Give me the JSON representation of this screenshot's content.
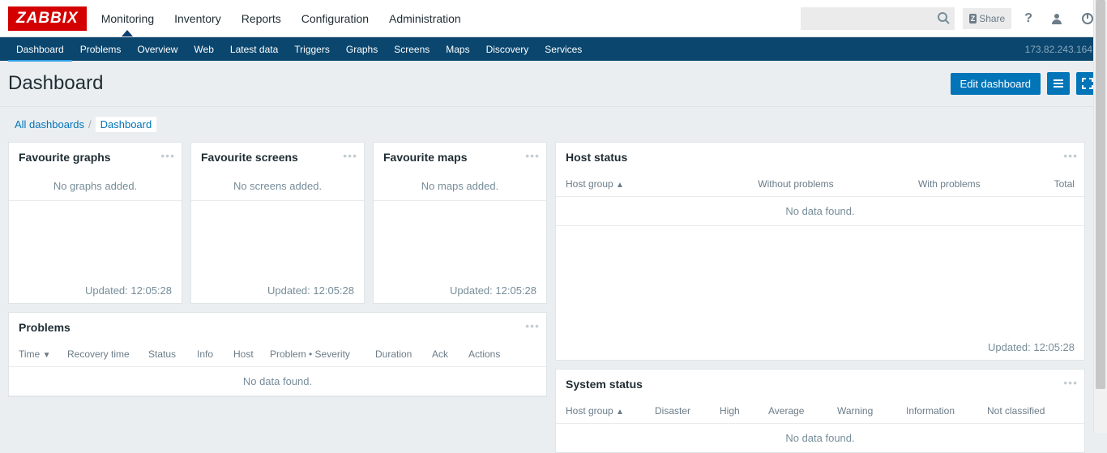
{
  "logo": "ZABBIX",
  "topnav": [
    "Monitoring",
    "Inventory",
    "Reports",
    "Configuration",
    "Administration"
  ],
  "topnav_active": 0,
  "share_label": "Share",
  "subnav": [
    "Dashboard",
    "Problems",
    "Overview",
    "Web",
    "Latest data",
    "Triggers",
    "Graphs",
    "Screens",
    "Maps",
    "Discovery",
    "Services"
  ],
  "subnav_active": 0,
  "ip": "173.82.243.164",
  "page_title": "Dashboard",
  "edit_btn": "Edit dashboard",
  "breadcrumb": {
    "root": "All dashboards",
    "current": "Dashboard"
  },
  "updated_prefix": "Updated: ",
  "updated_time": "12:05:28",
  "no_data": "No data found.",
  "fav_widgets": [
    {
      "title": "Favourite graphs",
      "empty": "No graphs added."
    },
    {
      "title": "Favourite screens",
      "empty": "No screens added."
    },
    {
      "title": "Favourite maps",
      "empty": "No maps added."
    }
  ],
  "problems": {
    "title": "Problems",
    "cols": [
      "Time",
      "Recovery time",
      "Status",
      "Info",
      "Host",
      "Problem • Severity",
      "Duration",
      "Ack",
      "Actions"
    ]
  },
  "host_status": {
    "title": "Host status",
    "cols": [
      "Host group",
      "Without problems",
      "With problems",
      "Total"
    ]
  },
  "system_status": {
    "title": "System status",
    "cols": [
      "Host group",
      "Disaster",
      "High",
      "Average",
      "Warning",
      "Information",
      "Not classified"
    ]
  }
}
